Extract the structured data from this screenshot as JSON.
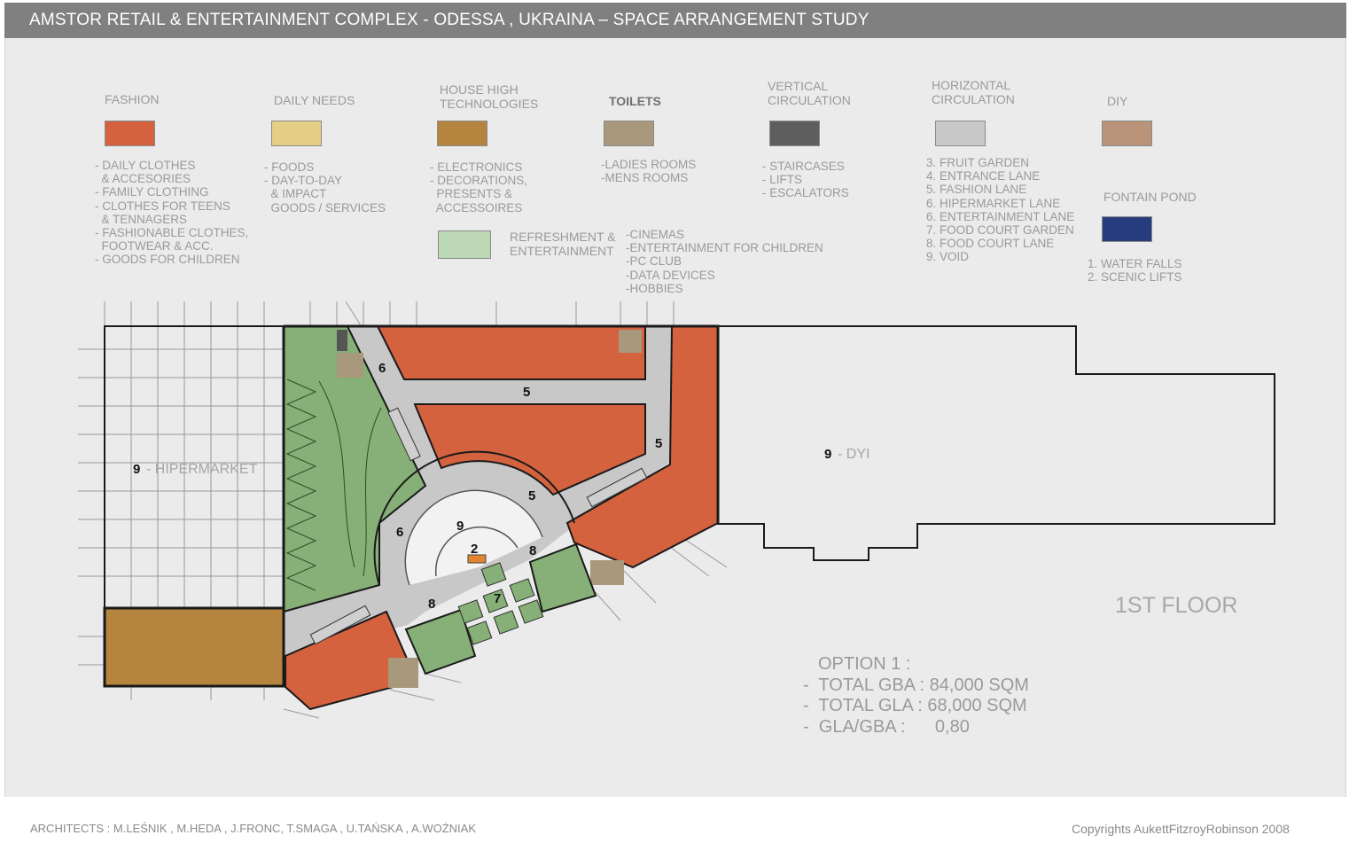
{
  "title": "AMSTOR RETAIL & ENTERTAINMENT COMPLEX  - ODESSA , UKRAINA – SPACE ARRANGEMENT  STUDY",
  "legend": [
    {
      "key": "fashion",
      "title": "FASHION",
      "color": "#d4623f",
      "items": "- DAILY CLOTHES\n  & ACCESORIES\n- FAMILY CLOTHING\n- CLOTHES FOR TEENS\n  & TENNAGERS\n- FASHIONABLE CLOTHES,\n  FOOTWEAR & ACC.\n- GOODS FOR CHILDREN"
    },
    {
      "key": "daily",
      "title": "DAILY NEEDS",
      "color": "#e6cf84",
      "items": "- FOODS\n- DAY-TO-DAY\n  & IMPACT\n  GOODS / SERVICES"
    },
    {
      "key": "hightech",
      "title": "HOUSE HIGH\nTECHNOLOGIES",
      "color": "#b5843f",
      "items": "- ELECTRONICS\n- DECORATIONS,\n  PRESENTS &\n  ACCESSOIRES"
    },
    {
      "key": "toilets",
      "title": "TOILETS",
      "color": "#a8987c",
      "items": "-LADIES ROOMS\n-MENS ROOMS"
    },
    {
      "key": "vertical",
      "title": "VERTICAL\nCIRCULATION",
      "color": "#5e5e5e",
      "items": "- STAIRCASES\n- LIFTS\n- ESCALATORS"
    },
    {
      "key": "horizontal",
      "title": "HORIZONTAL\nCIRCULATION",
      "color": "#c8c8c8",
      "items": "3. FRUIT GARDEN\n4. ENTRANCE LANE\n5. FASHION LANE\n6. HIPERMARKET LANE\n6. ENTERTAINMENT LANE\n7. FOOD COURT GARDEN\n8. FOOD COURT LANE\n9. VOID"
    },
    {
      "key": "diy",
      "title": "DIY",
      "color": "#b99479",
      "items": ""
    },
    {
      "key": "fontain",
      "title": "FONTAIN POND",
      "color": "#263c7c",
      "items": "1. WATER FALLS\n2. SCENIC LIFTS"
    },
    {
      "key": "refreshment",
      "title": "REFRESHMENT &\nENTERTAINMENT",
      "color": "#bcd8b4",
      "items": "-CINEMAS\n-ENTERTAINMENT FOR CHILDREN\n-PC CLUB\n-DATA DEVICES\n-HOBBIES"
    }
  ],
  "plan": {
    "hipermarket_num": "9",
    "hipermarket_label": "- HIPERMARKET",
    "dyi_num": "9",
    "dyi_label": "- DYI",
    "lane_labels": [
      "6",
      "5",
      "5",
      "5",
      "6",
      "9",
      "2",
      "8",
      "7",
      "8"
    ],
    "floor": "1ST FLOOR"
  },
  "stats": {
    "option": "OPTION 1 :",
    "gba": "-  TOTAL GBA : 84,000 SQM",
    "gla": "-  TOTAL GLA : 68,000 SQM",
    "ratio": "-  GLA/GBA :      0,80"
  },
  "footer": {
    "architects": "ARCHITECTS :  M.LEŚNIK , M.HEDA , J.FRONC, T.SMAGA , U.TAŃSKA , A.WOŹNIAK",
    "copyright": "Copyrights AukettFitzroyRobinson 2008"
  },
  "colors": {
    "header": "#808080",
    "panel": "#ebebeb",
    "green": "#86b077",
    "circulation": "#c8c8c8"
  }
}
